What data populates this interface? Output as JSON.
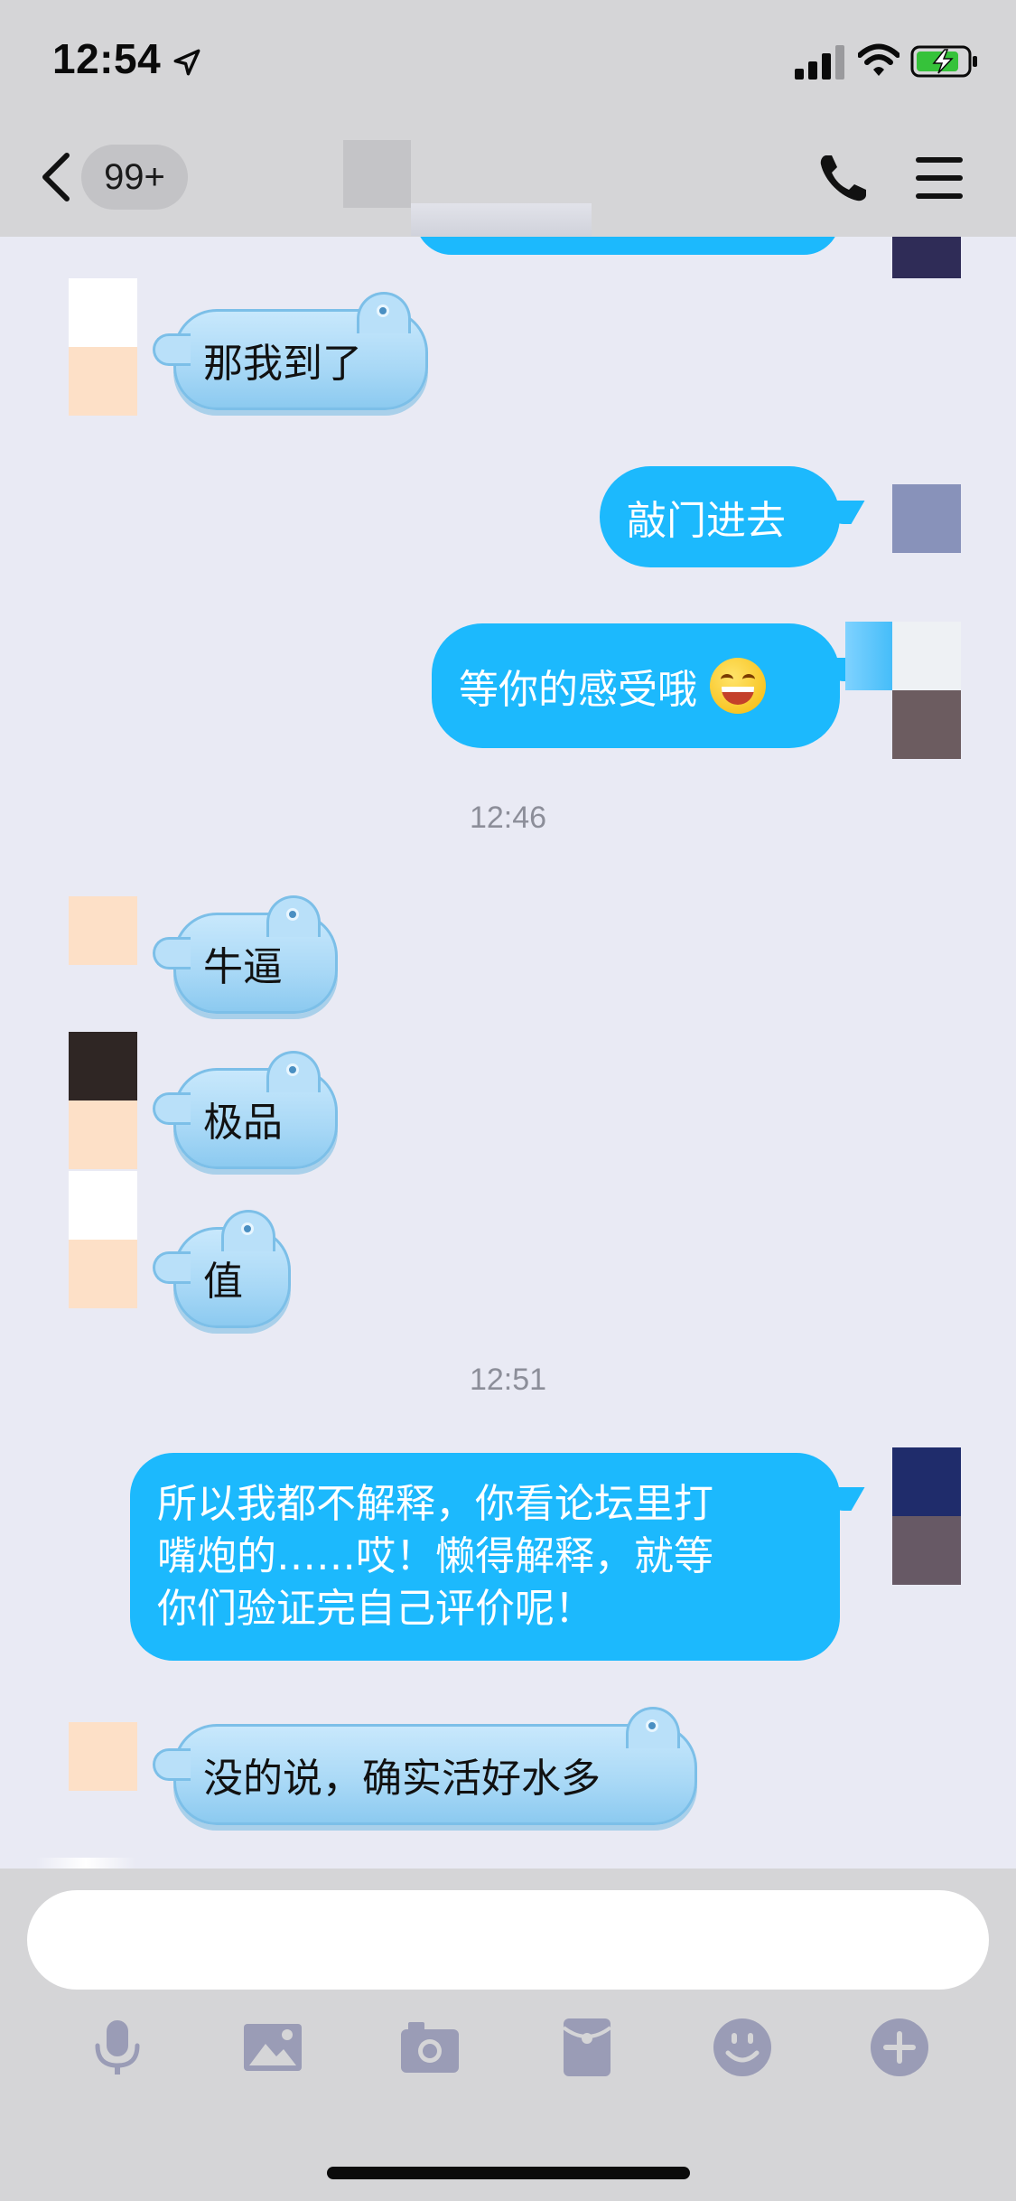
{
  "status_bar": {
    "time": "12:54"
  },
  "nav": {
    "unread_count": "99+"
  },
  "messages": [
    {
      "side": "in",
      "text": "那我到了"
    },
    {
      "side": "out",
      "text": "敲门进去"
    },
    {
      "side": "out",
      "text": "等你的感受哦"
    },
    {
      "type": "time",
      "text": "12:46"
    },
    {
      "side": "in",
      "text": "牛逼"
    },
    {
      "side": "in",
      "text": "极品"
    },
    {
      "side": "in",
      "text": "值"
    },
    {
      "type": "time",
      "text": "12:51"
    },
    {
      "side": "out",
      "lines": [
        "所以我都不解释，你看论坛里打",
        "嘴炮的……哎！懒得解释，就等",
        "你们验证完自己评价呢！"
      ]
    },
    {
      "side": "in",
      "text": "没的说，确实活好水多"
    }
  ],
  "input": {
    "placeholder": ""
  },
  "toolbar": {
    "icons": [
      "microphone-icon",
      "image-icon",
      "camera-icon",
      "red-packet-icon",
      "emoji-icon",
      "plus-icon"
    ]
  },
  "colors": {
    "outgoing_bubble": "#1cb9fd",
    "incoming_bubble": "#a8d8f6",
    "chat_background": "#e9eaf4",
    "bar_background": "#d5d5d7",
    "icon_color": "#9a9cb6"
  }
}
